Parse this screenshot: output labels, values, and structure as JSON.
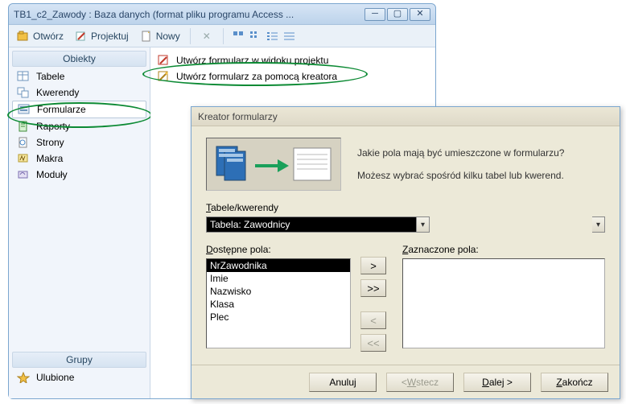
{
  "dbwin": {
    "title": "TB1_c2_Zawody : Baza danych (format pliku programu Access ...",
    "toolbar": {
      "open": "Otwórz",
      "design": "Projektuj",
      "new_": "Nowy"
    },
    "pane": {
      "objects_header": "Obiekty",
      "groups_header": "Grupy",
      "items": [
        {
          "label": "Tabele"
        },
        {
          "label": "Kwerendy"
        },
        {
          "label": "Formularze"
        },
        {
          "label": "Raporty"
        },
        {
          "label": "Strony"
        },
        {
          "label": "Makra"
        },
        {
          "label": "Moduły"
        }
      ],
      "favorites": "Ulubione"
    },
    "right": {
      "create_design": "Utwórz formularz w widoku projektu",
      "create_wizard": "Utwórz formularz za pomocą kreatora"
    }
  },
  "wizard": {
    "title": "Kreator formularzy",
    "prompt1": "Jakie pola mają być umieszczone w formularzu?",
    "prompt2": "Możesz wybrać spośród kilku tabel lub kwerend.",
    "combo_label": "Tabele/kwerendy",
    "combo_value": "Tabela: Zawodnicy",
    "available_label": "Dostępne pola:",
    "selected_label": "Zaznaczone pola:",
    "available_fields": [
      "NrZawodnika",
      "Imie",
      "Nazwisko",
      "Klasa",
      "Plec"
    ],
    "buttons": {
      "mv1": ">",
      "mv2": ">>",
      "mv3": "<",
      "mv4": "<<",
      "cancel": "Anuluj",
      "back": "< Wstecz",
      "next": "Dalej >",
      "finish": "Zakończ"
    }
  }
}
